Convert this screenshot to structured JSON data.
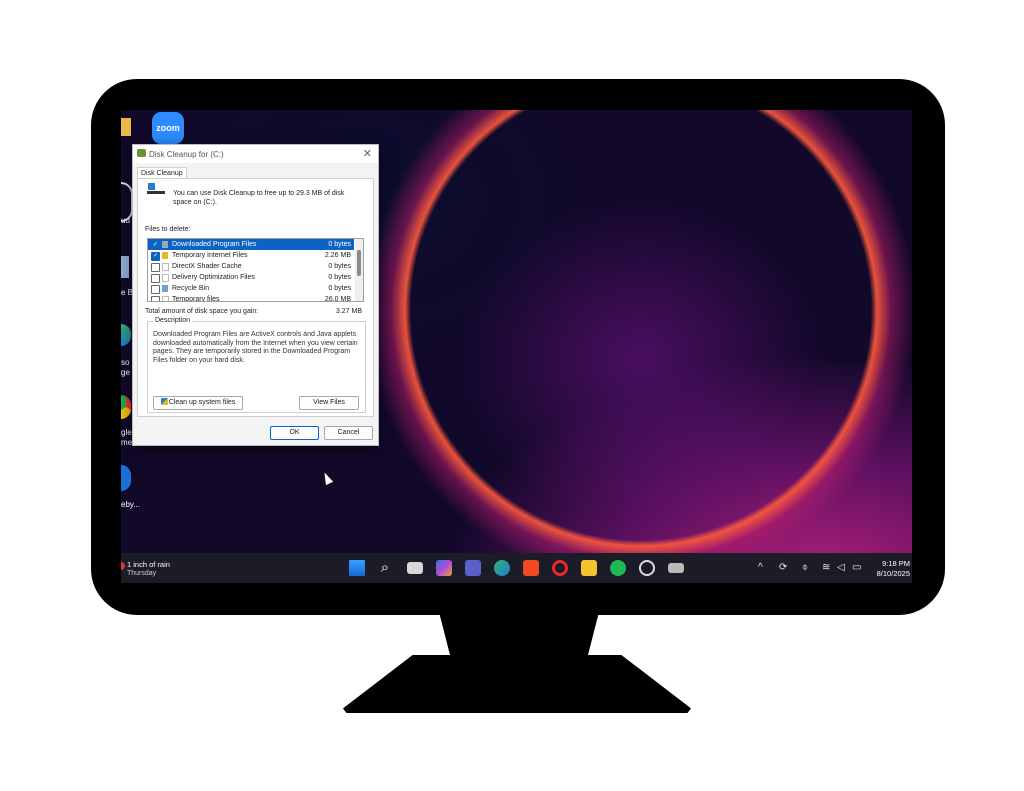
{
  "desktop": {
    "zoom_label": "zoom",
    "icon_labels": [
      "ud",
      "e B",
      "so\nge",
      "gle\nme",
      "eby..."
    ]
  },
  "dialog": {
    "title": "Disk Cleanup for  (C:)",
    "tab": "Disk Cleanup",
    "intro": "You can use Disk Cleanup to free up to 29.3 MB of disk space on  (C:).",
    "files_label": "Files to delete:",
    "files": [
      {
        "name": "Downloaded Program Files",
        "size": "0 bytes",
        "checked": true,
        "selected": true
      },
      {
        "name": "Temporary Internet Files",
        "size": "2.26 MB",
        "checked": true,
        "selected": false
      },
      {
        "name": "DirectX Shader Cache",
        "size": "0 bytes",
        "checked": false,
        "selected": false
      },
      {
        "name": "Delivery Optimization Files",
        "size": "0 bytes",
        "checked": false,
        "selected": false
      },
      {
        "name": "Recycle Bin",
        "size": "0 bytes",
        "checked": false,
        "selected": false
      },
      {
        "name": "Temporary files",
        "size": "26.0 MB",
        "checked": false,
        "selected": false
      }
    ],
    "total_label": "Total amount of disk space you gain:",
    "total_value": "3.27 MB",
    "description_title": "Description",
    "description": "Downloaded Program Files are ActiveX controls and Java applets downloaded automatically from the Internet when you view certain pages. They are temporarily stored in the Downloaded Program Files folder on your hard disk.",
    "cleanup_system_label": "Clean up system files",
    "view_files_label": "View Files",
    "ok_label": "OK",
    "cancel_label": "Cancel"
  },
  "taskbar": {
    "weather_line1": "1 inch of rain",
    "weather_line2": "Thursday",
    "time": "9:18 PM",
    "date": "8/10/2025"
  },
  "colors": {
    "selection": "#0b63c4",
    "taskbar": "#1c1c28"
  }
}
